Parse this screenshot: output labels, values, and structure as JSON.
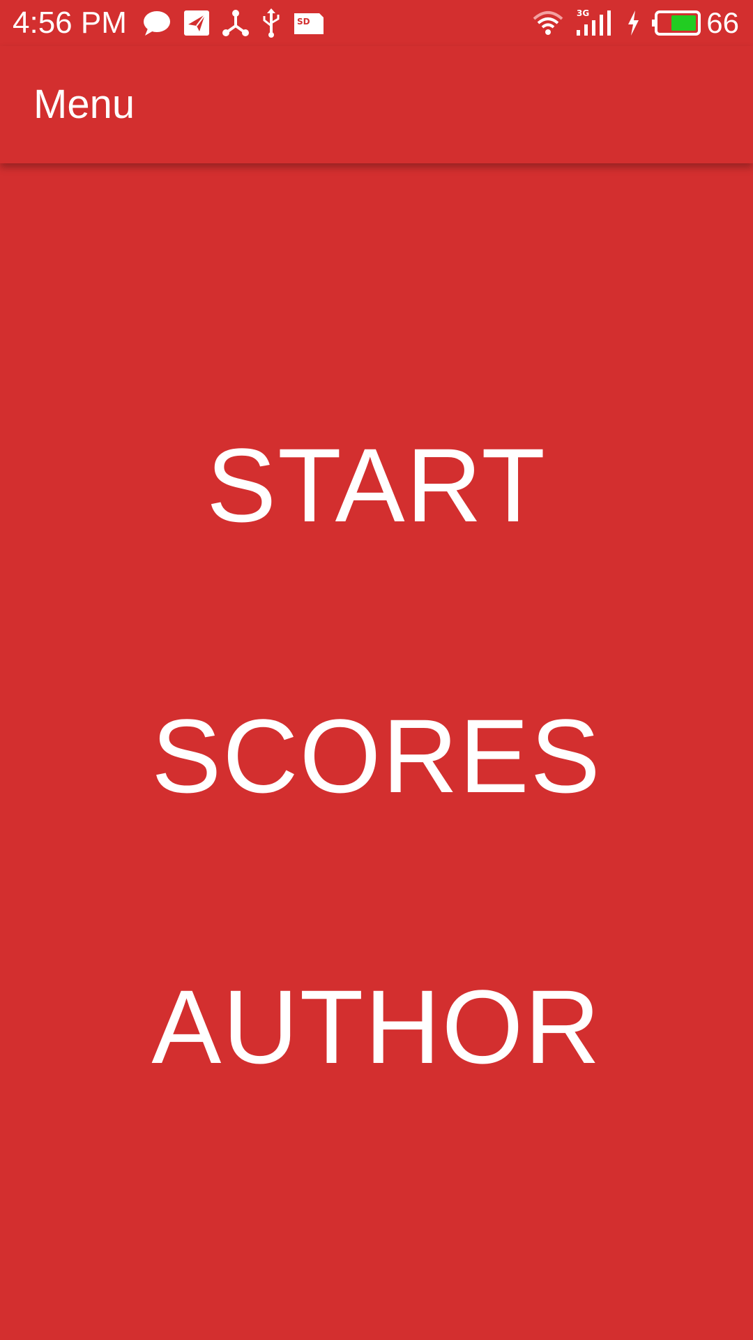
{
  "status_bar": {
    "time": "4:56 PM",
    "battery_level": "66",
    "network_type": "3G",
    "sd_label": "SD",
    "left_icons": [
      "chat-bubble-icon",
      "send-icon",
      "share-icon",
      "usb-icon",
      "sd-card-icon"
    ],
    "right_icons": [
      "wifi-icon",
      "signal-icon",
      "charging-icon",
      "battery-icon"
    ],
    "battery_fill_color": "#22cc22"
  },
  "app_bar": {
    "title": "Menu"
  },
  "menu": {
    "items": [
      {
        "label": "START"
      },
      {
        "label": "SCORES"
      },
      {
        "label": "AUTHOR"
      }
    ]
  },
  "colors": {
    "primary": "#d32f2f",
    "text": "#ffffff"
  }
}
